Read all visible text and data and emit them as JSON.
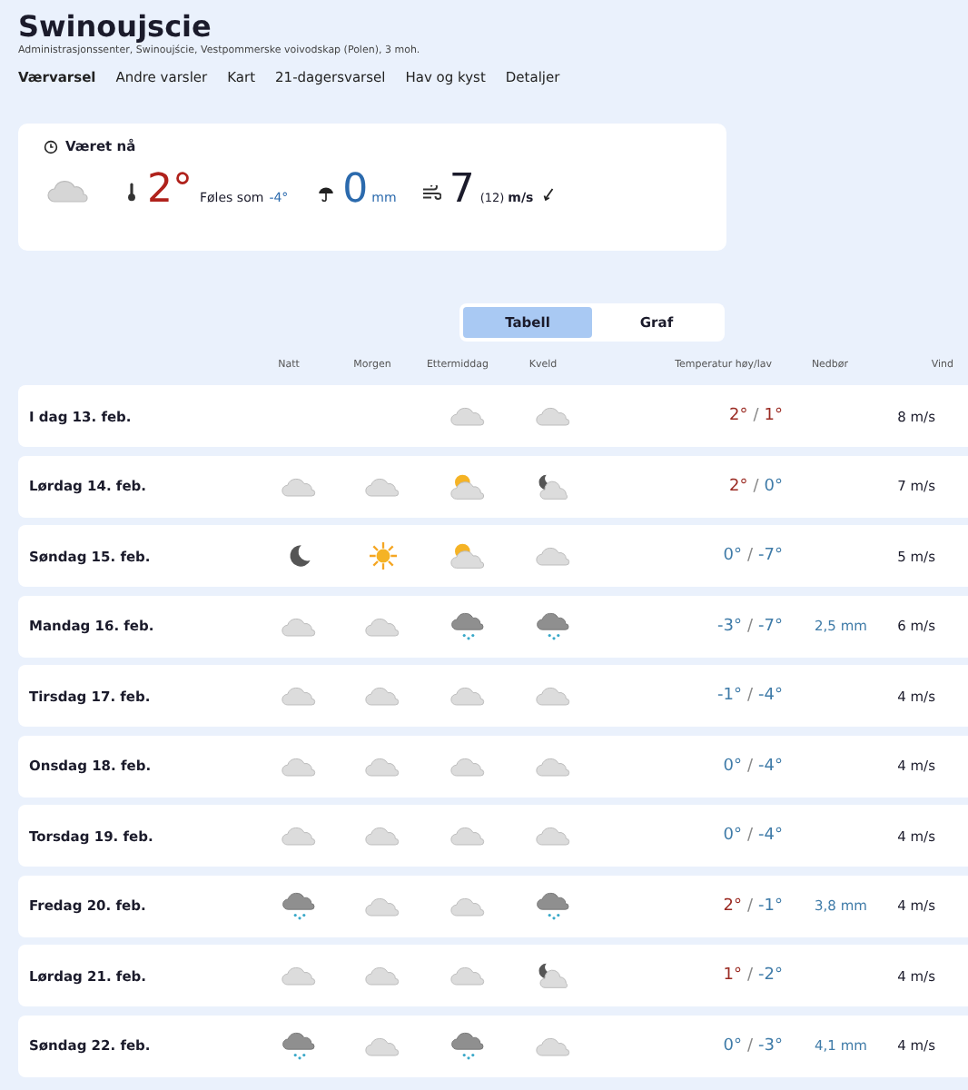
{
  "header": {
    "title": "Swinoujscie",
    "subtitle": "Administrasjonssenter, Swinoujście, Vestpommerske voivodskap (Polen), 3 moh."
  },
  "tabs": [
    {
      "label": "Værvarsel",
      "selected": true
    },
    {
      "label": "Andre varsler",
      "selected": false
    },
    {
      "label": "Kart",
      "selected": false
    },
    {
      "label": "21-dagersvarsel",
      "selected": false
    },
    {
      "label": "Hav og kyst",
      "selected": false
    },
    {
      "label": "Detaljer",
      "selected": false
    }
  ],
  "now": {
    "title": "Været nå",
    "icon": {
      "kind": "cloud"
    },
    "temperature": "2°",
    "feels_label": "Føles som",
    "feels_value": "-4°",
    "precip": "0",
    "precip_unit": "mm",
    "wind": "7",
    "gust": "(12)",
    "wind_unit": "m/s"
  },
  "view_toggle": [
    {
      "label": "Tabell",
      "selected": true
    },
    {
      "label": "Graf",
      "selected": false
    }
  ],
  "table": {
    "columns": [
      "Natt",
      "Morgen",
      "Ettermiddag",
      "Kveld",
      "Temperatur høy/lav",
      "Nedbør",
      "Vind"
    ],
    "rows": [
      {
        "date": "I dag 13. feb.",
        "icons": [
          {
            "kind": "none"
          },
          {
            "kind": "none"
          },
          {
            "kind": "cloud"
          },
          {
            "kind": "cloud"
          }
        ],
        "high": {
          "text": "2°",
          "warm": true
        },
        "sep": "/",
        "low": {
          "text": "1°",
          "warm": true
        },
        "wind": "8 m/s"
      },
      {
        "date": "Lørdag 14. feb.",
        "icons": [
          {
            "kind": "cloud"
          },
          {
            "kind": "cloud"
          },
          {
            "kind": "partsun"
          },
          {
            "kind": "partmoon"
          }
        ],
        "high": {
          "text": "2°",
          "warm": true
        },
        "sep": "/",
        "low": {
          "text": "0°",
          "warm": false
        },
        "wind": "7 m/s"
      },
      {
        "date": "Søndag 15. feb.",
        "icons": [
          {
            "kind": "moon"
          },
          {
            "kind": "sun"
          },
          {
            "kind": "partsun"
          },
          {
            "kind": "cloud"
          }
        ],
        "high": {
          "text": "0°",
          "warm": false
        },
        "sep": "/",
        "low": {
          "text": "-7°",
          "warm": false
        },
        "wind": "5 m/s"
      },
      {
        "date": "Mandag 16. feb.",
        "icons": [
          {
            "kind": "cloud"
          },
          {
            "kind": "cloud"
          },
          {
            "kind": "snow"
          },
          {
            "kind": "snow"
          }
        ],
        "high": {
          "text": "-3°",
          "warm": false
        },
        "sep": "/",
        "low": {
          "text": "-7°",
          "warm": false
        },
        "precip": "2,5 mm",
        "wind": "6 m/s"
      },
      {
        "date": "Tirsdag 17. feb.",
        "icons": [
          {
            "kind": "cloud"
          },
          {
            "kind": "cloud"
          },
          {
            "kind": "cloud"
          },
          {
            "kind": "cloud"
          }
        ],
        "high": {
          "text": "-1°",
          "warm": false
        },
        "sep": "/",
        "low": {
          "text": "-4°",
          "warm": false
        },
        "wind": "4 m/s"
      },
      {
        "date": "Onsdag 18. feb.",
        "icons": [
          {
            "kind": "cloud"
          },
          {
            "kind": "cloud"
          },
          {
            "kind": "cloud"
          },
          {
            "kind": "cloud"
          }
        ],
        "high": {
          "text": "0°",
          "warm": false
        },
        "sep": "/",
        "low": {
          "text": "-4°",
          "warm": false
        },
        "wind": "4 m/s"
      },
      {
        "date": "Torsdag 19. feb.",
        "icons": [
          {
            "kind": "cloud"
          },
          {
            "kind": "cloud"
          },
          {
            "kind": "cloud"
          },
          {
            "kind": "cloud"
          }
        ],
        "high": {
          "text": "0°",
          "warm": false
        },
        "sep": "/",
        "low": {
          "text": "-4°",
          "warm": false
        },
        "wind": "4 m/s"
      },
      {
        "date": "Fredag 20. feb.",
        "icons": [
          {
            "kind": "snow"
          },
          {
            "kind": "cloud"
          },
          {
            "kind": "cloud"
          },
          {
            "kind": "snow"
          }
        ],
        "high": {
          "text": "2°",
          "warm": true
        },
        "sep": "/",
        "low": {
          "text": "-1°",
          "warm": false
        },
        "precip": "3,8 mm",
        "wind": "4 m/s"
      },
      {
        "date": "Lørdag 21. feb.",
        "icons": [
          {
            "kind": "cloud"
          },
          {
            "kind": "cloud"
          },
          {
            "kind": "cloud"
          },
          {
            "kind": "partmoon"
          }
        ],
        "high": {
          "text": "1°",
          "warm": true
        },
        "sep": "/",
        "low": {
          "text": "-2°",
          "warm": false
        },
        "wind": "4 m/s"
      },
      {
        "date": "Søndag 22. feb.",
        "icons": [
          {
            "kind": "snow"
          },
          {
            "kind": "cloud"
          },
          {
            "kind": "snow"
          },
          {
            "kind": "cloud"
          }
        ],
        "high": {
          "text": "0°",
          "warm": false
        },
        "sep": "/",
        "low": {
          "text": "-3°",
          "warm": false
        },
        "precip": "4,1 mm",
        "wind": "4 m/s"
      }
    ]
  }
}
